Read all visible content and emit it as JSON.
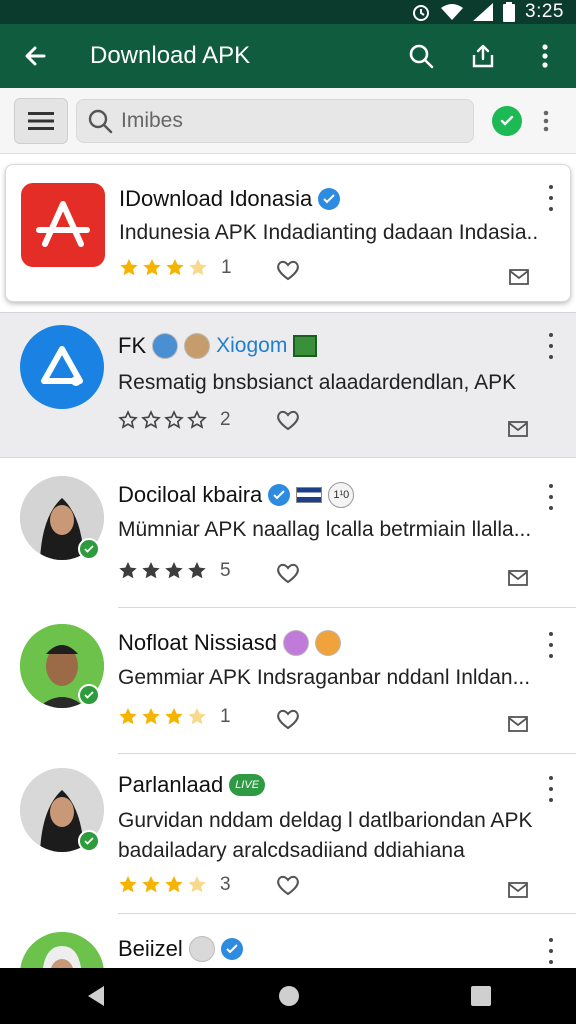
{
  "status_bar": {
    "time": "3:25",
    "icons": [
      "alarm-icon",
      "wifi-icon",
      "signal-icon",
      "battery-icon"
    ],
    "background": "#0b3b2c"
  },
  "app_bar": {
    "title": "Download APK",
    "background": "#0f5c3e",
    "actions": [
      "search-icon",
      "share-icon",
      "more-vert-icon"
    ]
  },
  "search": {
    "placeholder": "Imibes",
    "value": ""
  },
  "items": [
    {
      "name": "IDownload Idonasia",
      "description": "Indunesia APK Indadianting dadaan Indasia..",
      "rating": 3.5,
      "count": "1",
      "icon": "app-store-icon",
      "icon_color": "#e52d27",
      "verified": true
    },
    {
      "name": "FK",
      "channel": "Xiogom",
      "description": "Resmatig bnsbsianct alaadardendlan, APK",
      "rating": 0,
      "count": "2",
      "icon": "circle-a-icon",
      "icon_color": "#1a82e2"
    },
    {
      "name": "Dociloal kbaira",
      "badge_number": "1¹0",
      "description": "Mümniar APK naallag lcalla betrmiain llalla...",
      "rating": 4,
      "count": "5",
      "verified": true
    },
    {
      "name": "Nofloat Nissiasd",
      "description": "Gemmiar APK Indsraganbar nddanl Inldan...",
      "rating": 3.5,
      "count": "1"
    },
    {
      "name": "Parlanlaad",
      "pill": "LIVE",
      "description_line1": "Gurvidan nddam deldag l datlbariondan APK",
      "description_line2": "badailadary aralcdsadiiand ddiahiana",
      "rating": 3.5,
      "count": "3"
    },
    {
      "name": "Beiizel",
      "verified": true
    }
  ],
  "colors": {
    "accent": "#0f5c3e",
    "star": "#f4b400",
    "verified": "#2d8ce0"
  }
}
